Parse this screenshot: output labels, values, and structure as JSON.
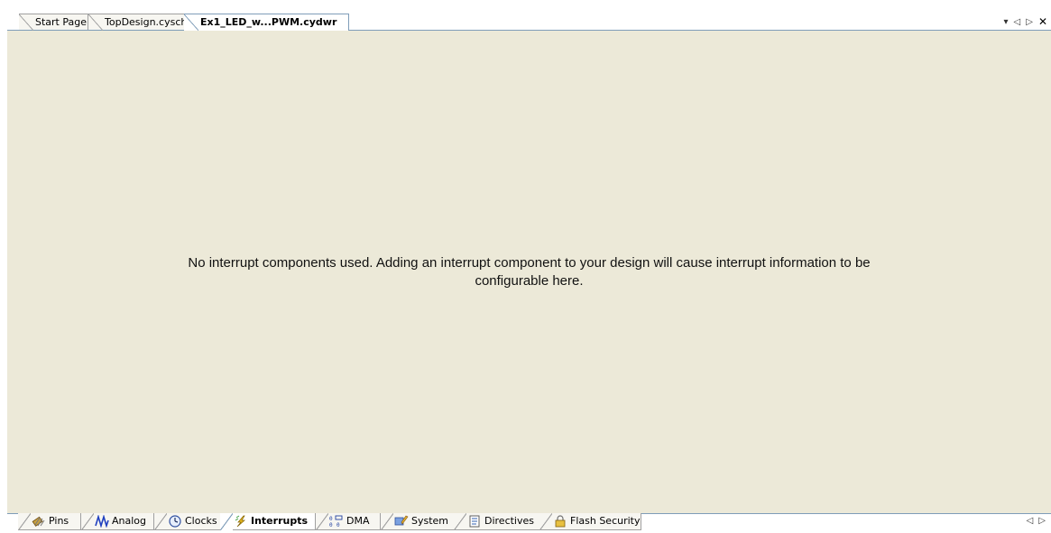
{
  "doc_tabs": [
    {
      "label": "Start Page",
      "active": false
    },
    {
      "label": "TopDesign.cysch",
      "active": false
    },
    {
      "label": "Ex1_LED_w...PWM.cydwr",
      "active": true
    }
  ],
  "window_controls": {
    "dropdown": "▾",
    "scroll_left": "◁",
    "scroll_right": "▷",
    "close": "✕"
  },
  "main": {
    "message_line1": "No interrupt components used. Adding an interrupt component to your design will cause interrupt information to be",
    "message_line2": "configurable here."
  },
  "bottom_tabs": [
    {
      "label": "Pins",
      "icon": "pins-icon",
      "active": false
    },
    {
      "label": "Analog",
      "icon": "analog-wave-icon",
      "active": false
    },
    {
      "label": "Clocks",
      "icon": "clock-icon",
      "active": false
    },
    {
      "label": "Interrupts",
      "icon": "lightning-icon",
      "active": true
    },
    {
      "label": "DMA",
      "icon": "dma-icon",
      "active": false
    },
    {
      "label": "System",
      "icon": "system-icon",
      "active": false
    },
    {
      "label": "Directives",
      "icon": "document-icon",
      "active": false
    },
    {
      "label": "Flash Security",
      "icon": "lock-icon",
      "active": false
    }
  ],
  "bottom_controls": {
    "scroll_left": "◁",
    "scroll_right": "▷"
  },
  "colors": {
    "content_bg": "#ece9d8",
    "frame_border": "#7f9db9"
  }
}
